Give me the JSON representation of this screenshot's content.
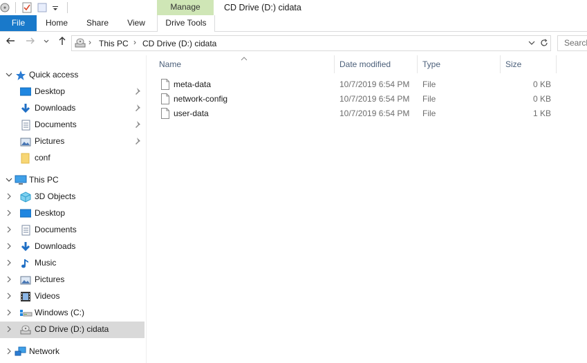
{
  "ribbon": {
    "context_group": "Manage",
    "window_title": "CD Drive (D:) cidata",
    "tabs": [
      "File",
      "Home",
      "Share",
      "View",
      "Drive Tools"
    ]
  },
  "address": {
    "crumbs": [
      "This PC",
      "CD Drive (D:) cidata"
    ],
    "search_placeholder": "Search"
  },
  "navigation": {
    "quick_access": {
      "label": "Quick access",
      "items": [
        {
          "label": "Desktop",
          "icon": "desktop-icon",
          "pinned": true
        },
        {
          "label": "Downloads",
          "icon": "downloads-icon",
          "pinned": true
        },
        {
          "label": "Documents",
          "icon": "documents-icon",
          "pinned": true
        },
        {
          "label": "Pictures",
          "icon": "pictures-icon",
          "pinned": true
        },
        {
          "label": "conf",
          "icon": "folder-icon",
          "pinned": false
        }
      ]
    },
    "this_pc": {
      "label": "This PC",
      "items": [
        {
          "label": "3D Objects",
          "icon": "3d-objects-icon"
        },
        {
          "label": "Desktop",
          "icon": "desktop-icon"
        },
        {
          "label": "Documents",
          "icon": "documents-icon"
        },
        {
          "label": "Downloads",
          "icon": "downloads-icon"
        },
        {
          "label": "Music",
          "icon": "music-icon"
        },
        {
          "label": "Pictures",
          "icon": "pictures-icon"
        },
        {
          "label": "Videos",
          "icon": "videos-icon"
        },
        {
          "label": "Windows (C:)",
          "icon": "drive-icon"
        },
        {
          "label": "CD Drive (D:) cidata",
          "icon": "cd-drive-icon",
          "selected": true
        }
      ]
    },
    "network": {
      "label": "Network"
    }
  },
  "content": {
    "columns": [
      "Name",
      "Date modified",
      "Type",
      "Size"
    ],
    "files": [
      {
        "name": "meta-data",
        "date": "10/7/2019 6:54 PM",
        "type": "File",
        "size": "0 KB"
      },
      {
        "name": "network-config",
        "date": "10/7/2019 6:54 PM",
        "type": "File",
        "size": "0 KB"
      },
      {
        "name": "user-data",
        "date": "10/7/2019 6:54 PM",
        "type": "File",
        "size": "1 KB"
      }
    ]
  },
  "colors": {
    "file_tab": "#1979ca",
    "manage_group": "#cfe6b6",
    "selected_nav": "#d9d9d9",
    "column_header": "#4c607a"
  }
}
